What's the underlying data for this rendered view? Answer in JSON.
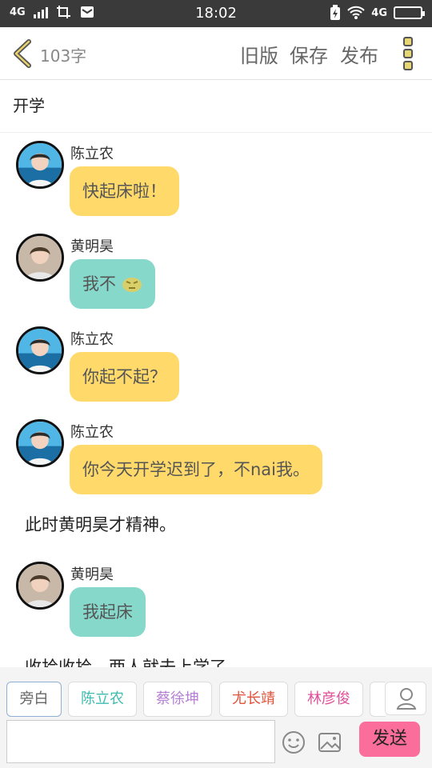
{
  "status_bar": {
    "network_left": "4G",
    "time": "18:02",
    "network_right": "4G"
  },
  "toolbar": {
    "word_count": "103字",
    "old_version": "旧版",
    "save": "保存",
    "publish": "发布"
  },
  "story": {
    "title": "开学"
  },
  "messages": [
    {
      "type": "dialogue",
      "sender": "陈立农",
      "text": "快起床啦！",
      "color": "#ffda6b"
    },
    {
      "type": "dialogue",
      "sender": "黄明昊",
      "text": "我不",
      "emoji": "angry-face-emoji",
      "color": "#86d8cb"
    },
    {
      "type": "dialogue",
      "sender": "陈立农",
      "text": "你起不起？",
      "color": "#ffda6b"
    },
    {
      "type": "dialogue",
      "sender": "陈立农",
      "text": "你今天开学迟到了，不nai我。",
      "color": "#ffda6b"
    },
    {
      "type": "narration",
      "text": "此时黄明昊才精神。"
    },
    {
      "type": "dialogue",
      "sender": "黄明昊",
      "text": "我起床",
      "color": "#86d8cb"
    },
    {
      "type": "narration",
      "text": "收拾收拾，两人就去上学了。"
    }
  ],
  "characters": [
    {
      "name": "旁白",
      "color": "#666666"
    },
    {
      "name": "陈立农",
      "color": "#3fbcb0"
    },
    {
      "name": "蔡徐坤",
      "color": "#b57fd6"
    },
    {
      "name": "尤长靖",
      "color": "#e0533a"
    },
    {
      "name": "林彦俊",
      "color": "#e0509a"
    }
  ],
  "composer": {
    "input_value": "",
    "send_label": "发送"
  },
  "colors": {
    "accent_yellow": "#ffda6b",
    "accent_teal": "#86d8cb",
    "send_pink": "#fb6d9a"
  }
}
